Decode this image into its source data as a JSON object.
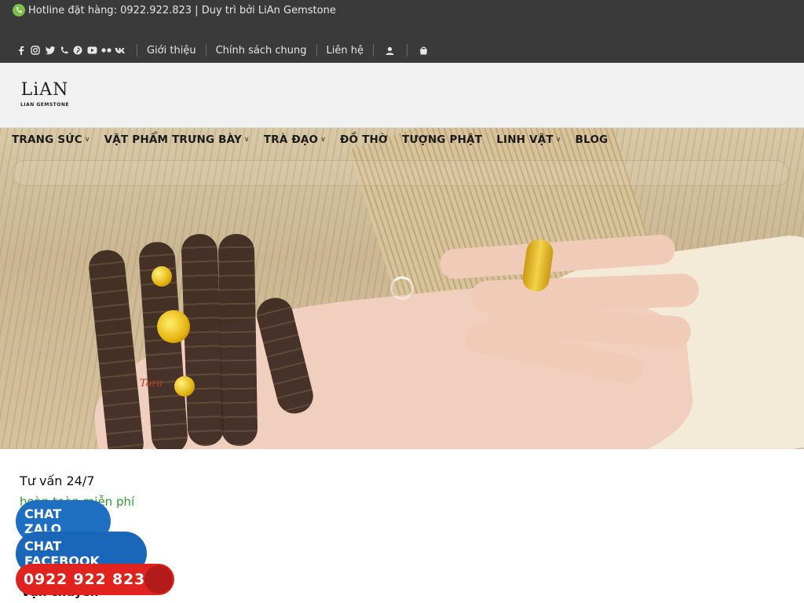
{
  "topbar": {
    "hotline": "Hotline đặt hàng: 0922.922.823 | Duy trì bởi LiAn Gemstone",
    "social_icons": [
      "facebook-icon",
      "instagram-icon",
      "twitter-icon",
      "phone-icon",
      "pinterest-icon",
      "youtube-icon",
      "flickr-icon",
      "vk-icon"
    ],
    "links": [
      "Giới thiệu",
      "Chính sách chung",
      "Liên hệ"
    ]
  },
  "header": {
    "logo_mark": "LiAN",
    "logo_text": "LIAN GEMSTONE"
  },
  "nav": {
    "items": [
      "TRANG SỨC",
      "VẬT PHẨM TRƯNG BÀY",
      "TRÀ ĐẠO",
      "ĐỒ THỜ",
      "TƯỢNG PHẬT",
      "LINH VẬT",
      "BLOG"
    ],
    "hero_watermark": "Tara"
  },
  "search": {
    "placeholder": ""
  },
  "content": {
    "consult_title": "Tư vấn 24/7",
    "consult_sub": "hoàn toàn miễn phí",
    "shipping": "Vận chuyển"
  },
  "floating": {
    "chat_zalo": "CHAT ZALO",
    "chat_facebook": "CHAT FACEBOOK",
    "phone": "0922 922 823"
  },
  "colors": {
    "topbar": "#3a3a3a",
    "accent_green": "#2f9a2f",
    "zalo_blue": "#1e6fc2",
    "phone_red": "#e0231f"
  }
}
